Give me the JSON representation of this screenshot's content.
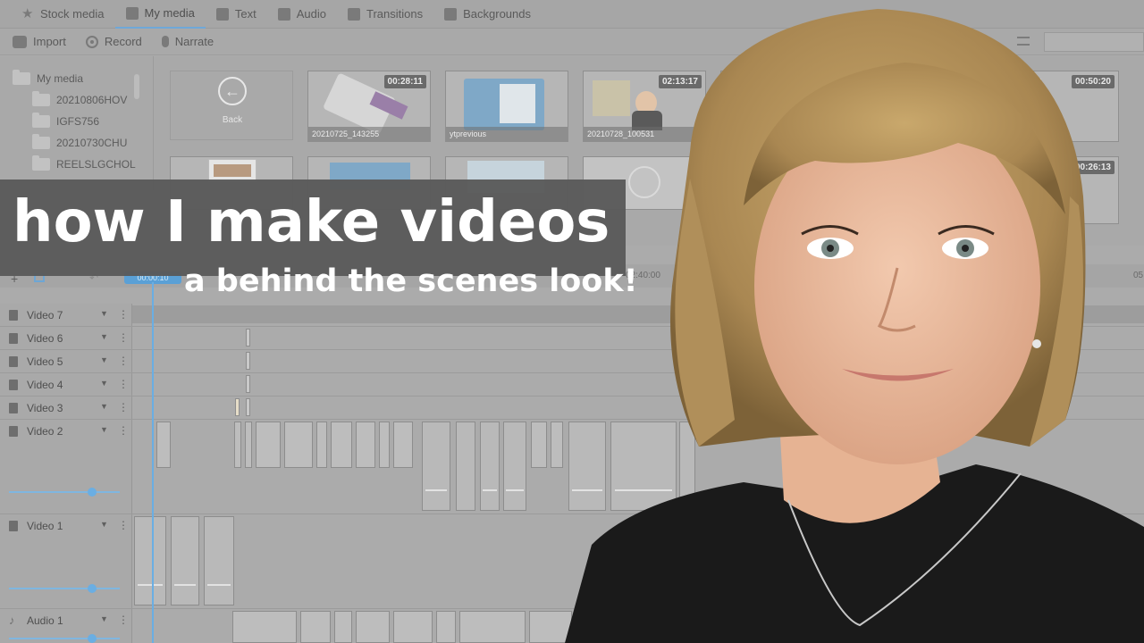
{
  "tabs": [
    {
      "label": "Stock media",
      "icon": "star-icon",
      "active": false
    },
    {
      "label": "My media",
      "icon": "folder-icon",
      "active": true
    },
    {
      "label": "Text",
      "icon": "text-icon",
      "active": false
    },
    {
      "label": "Audio",
      "icon": "music-icon",
      "active": false
    },
    {
      "label": "Transitions",
      "icon": "transitions-icon",
      "active": false
    },
    {
      "label": "Backgrounds",
      "icon": "backgrounds-icon",
      "active": false
    }
  ],
  "toolbar": {
    "import_label": "Import",
    "record_label": "Record",
    "narrate_label": "Narrate"
  },
  "tree": {
    "root": "My media",
    "folders": [
      "20210806HOV",
      "IGFS756",
      "20210730CHU",
      "REELSLGCHOL"
    ]
  },
  "media": {
    "back_label": "Back",
    "thumbs": [
      {
        "name": "20210725_143255",
        "duration": "00:28:11"
      },
      {
        "name": "ytprevious",
        "duration": ""
      },
      {
        "name": "20210728_100531",
        "duration": "02:13:17"
      },
      {
        "name": "",
        "duration": "00:50:20"
      },
      {
        "name": "",
        "duration": "00:26:13"
      }
    ]
  },
  "timeline": {
    "playhead_time": "00:00:10",
    "ruler_marks": [
      "02:40:00",
      "05"
    ],
    "tracks": [
      {
        "label": "Video 7",
        "type": "video"
      },
      {
        "label": "Video 6",
        "type": "video"
      },
      {
        "label": "Video 5",
        "type": "video"
      },
      {
        "label": "Video 4",
        "type": "video"
      },
      {
        "label": "Video 3",
        "type": "video"
      },
      {
        "label": "Video 2",
        "type": "video"
      },
      {
        "label": "Video 1",
        "type": "video"
      },
      {
        "label": "Audio 1",
        "type": "audio"
      }
    ]
  },
  "overlay": {
    "title": "how I make  videos",
    "subtitle": "a behind the scenes look!"
  },
  "colors": {
    "accent": "#6aaee3",
    "ui_gray": "#a9a9a9",
    "title_band": "#5a5a5a"
  }
}
